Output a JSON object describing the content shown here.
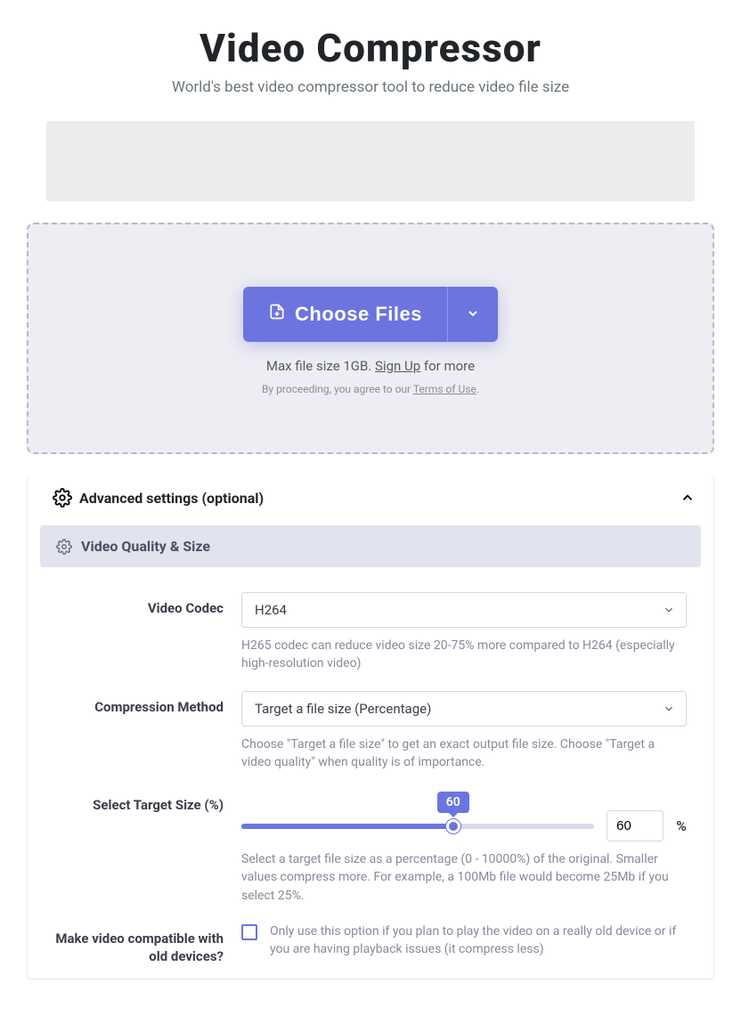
{
  "header": {
    "title": "Video Compressor",
    "subtitle": "World's best video compressor tool to reduce video file size"
  },
  "dropzone": {
    "choose_label": "Choose Files",
    "limit_prefix": "Max file size 1GB. ",
    "signup_label": "Sign Up",
    "limit_suffix": " for more",
    "terms_prefix": "By proceeding, you agree to our ",
    "terms_label": "Terms of Use",
    "terms_suffix": "."
  },
  "advanced": {
    "header_label": "Advanced settings (optional)",
    "section_label": "Video Quality & Size",
    "codec": {
      "label": "Video Codec",
      "value": "H264",
      "help": "H265 codec can reduce video size 20-75% more compared to H264 (especially high-resolution video)"
    },
    "method": {
      "label": "Compression Method",
      "value": "Target a file size (Percentage)",
      "help": "Choose \"Target a file size\" to get an exact output file size. Choose \"Target a video quality\" when quality is of importance."
    },
    "target": {
      "label": "Select Target Size (%)",
      "tooltip": "60",
      "input_value": "60",
      "pct_symbol": "%",
      "help": "Select a target file size as a percentage (0 - 10000%) of the original. Smaller values compress more. For example, a 100Mb file would become 25Mb if you select 25%."
    },
    "compat": {
      "label": "Make video compatible with old devices?",
      "help": "Only use this option if you plan to play the video on a really old device or if you are having playback issues (it compress less)"
    }
  }
}
